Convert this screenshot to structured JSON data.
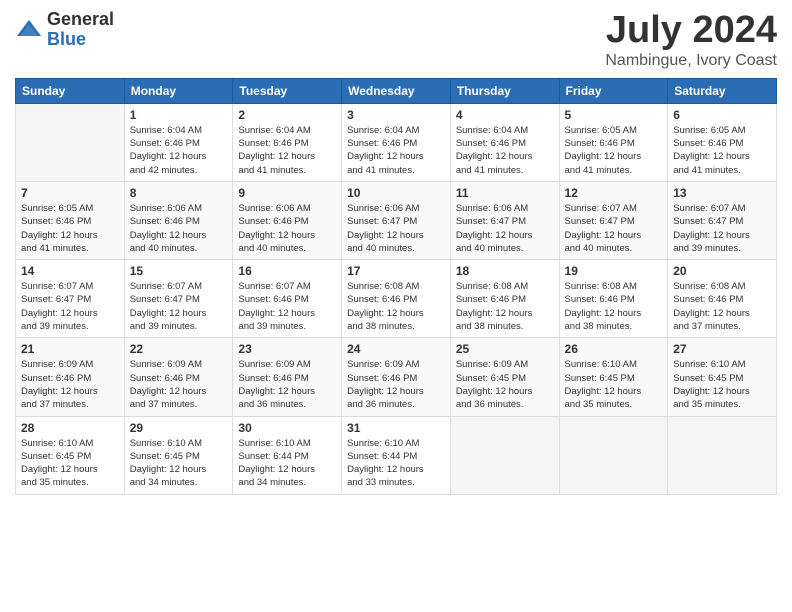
{
  "logo": {
    "general": "General",
    "blue": "Blue"
  },
  "title": "July 2024",
  "subtitle": "Nambingue, Ivory Coast",
  "header_days": [
    "Sunday",
    "Monday",
    "Tuesday",
    "Wednesday",
    "Thursday",
    "Friday",
    "Saturday"
  ],
  "weeks": [
    [
      {
        "day": "",
        "info": ""
      },
      {
        "day": "1",
        "info": "Sunrise: 6:04 AM\nSunset: 6:46 PM\nDaylight: 12 hours\nand 42 minutes."
      },
      {
        "day": "2",
        "info": "Sunrise: 6:04 AM\nSunset: 6:46 PM\nDaylight: 12 hours\nand 41 minutes."
      },
      {
        "day": "3",
        "info": "Sunrise: 6:04 AM\nSunset: 6:46 PM\nDaylight: 12 hours\nand 41 minutes."
      },
      {
        "day": "4",
        "info": "Sunrise: 6:04 AM\nSunset: 6:46 PM\nDaylight: 12 hours\nand 41 minutes."
      },
      {
        "day": "5",
        "info": "Sunrise: 6:05 AM\nSunset: 6:46 PM\nDaylight: 12 hours\nand 41 minutes."
      },
      {
        "day": "6",
        "info": "Sunrise: 6:05 AM\nSunset: 6:46 PM\nDaylight: 12 hours\nand 41 minutes."
      }
    ],
    [
      {
        "day": "7",
        "info": "Sunrise: 6:05 AM\nSunset: 6:46 PM\nDaylight: 12 hours\nand 41 minutes."
      },
      {
        "day": "8",
        "info": "Sunrise: 6:06 AM\nSunset: 6:46 PM\nDaylight: 12 hours\nand 40 minutes."
      },
      {
        "day": "9",
        "info": "Sunrise: 6:06 AM\nSunset: 6:46 PM\nDaylight: 12 hours\nand 40 minutes."
      },
      {
        "day": "10",
        "info": "Sunrise: 6:06 AM\nSunset: 6:47 PM\nDaylight: 12 hours\nand 40 minutes."
      },
      {
        "day": "11",
        "info": "Sunrise: 6:06 AM\nSunset: 6:47 PM\nDaylight: 12 hours\nand 40 minutes."
      },
      {
        "day": "12",
        "info": "Sunrise: 6:07 AM\nSunset: 6:47 PM\nDaylight: 12 hours\nand 40 minutes."
      },
      {
        "day": "13",
        "info": "Sunrise: 6:07 AM\nSunset: 6:47 PM\nDaylight: 12 hours\nand 39 minutes."
      }
    ],
    [
      {
        "day": "14",
        "info": "Sunrise: 6:07 AM\nSunset: 6:47 PM\nDaylight: 12 hours\nand 39 minutes."
      },
      {
        "day": "15",
        "info": "Sunrise: 6:07 AM\nSunset: 6:47 PM\nDaylight: 12 hours\nand 39 minutes."
      },
      {
        "day": "16",
        "info": "Sunrise: 6:07 AM\nSunset: 6:46 PM\nDaylight: 12 hours\nand 39 minutes."
      },
      {
        "day": "17",
        "info": "Sunrise: 6:08 AM\nSunset: 6:46 PM\nDaylight: 12 hours\nand 38 minutes."
      },
      {
        "day": "18",
        "info": "Sunrise: 6:08 AM\nSunset: 6:46 PM\nDaylight: 12 hours\nand 38 minutes."
      },
      {
        "day": "19",
        "info": "Sunrise: 6:08 AM\nSunset: 6:46 PM\nDaylight: 12 hours\nand 38 minutes."
      },
      {
        "day": "20",
        "info": "Sunrise: 6:08 AM\nSunset: 6:46 PM\nDaylight: 12 hours\nand 37 minutes."
      }
    ],
    [
      {
        "day": "21",
        "info": "Sunrise: 6:09 AM\nSunset: 6:46 PM\nDaylight: 12 hours\nand 37 minutes."
      },
      {
        "day": "22",
        "info": "Sunrise: 6:09 AM\nSunset: 6:46 PM\nDaylight: 12 hours\nand 37 minutes."
      },
      {
        "day": "23",
        "info": "Sunrise: 6:09 AM\nSunset: 6:46 PM\nDaylight: 12 hours\nand 36 minutes."
      },
      {
        "day": "24",
        "info": "Sunrise: 6:09 AM\nSunset: 6:46 PM\nDaylight: 12 hours\nand 36 minutes."
      },
      {
        "day": "25",
        "info": "Sunrise: 6:09 AM\nSunset: 6:45 PM\nDaylight: 12 hours\nand 36 minutes."
      },
      {
        "day": "26",
        "info": "Sunrise: 6:10 AM\nSunset: 6:45 PM\nDaylight: 12 hours\nand 35 minutes."
      },
      {
        "day": "27",
        "info": "Sunrise: 6:10 AM\nSunset: 6:45 PM\nDaylight: 12 hours\nand 35 minutes."
      }
    ],
    [
      {
        "day": "28",
        "info": "Sunrise: 6:10 AM\nSunset: 6:45 PM\nDaylight: 12 hours\nand 35 minutes."
      },
      {
        "day": "29",
        "info": "Sunrise: 6:10 AM\nSunset: 6:45 PM\nDaylight: 12 hours\nand 34 minutes."
      },
      {
        "day": "30",
        "info": "Sunrise: 6:10 AM\nSunset: 6:44 PM\nDaylight: 12 hours\nand 34 minutes."
      },
      {
        "day": "31",
        "info": "Sunrise: 6:10 AM\nSunset: 6:44 PM\nDaylight: 12 hours\nand 33 minutes."
      },
      {
        "day": "",
        "info": ""
      },
      {
        "day": "",
        "info": ""
      },
      {
        "day": "",
        "info": ""
      }
    ]
  ]
}
